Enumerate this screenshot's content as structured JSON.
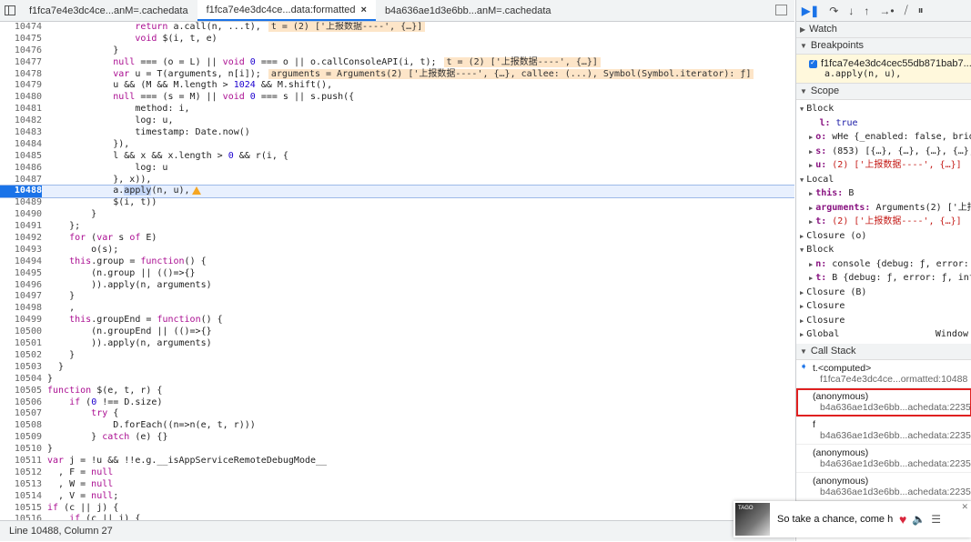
{
  "tabs": [
    {
      "label": "f1fca7e4e3dc4ce...anM=.cachedata",
      "active": false,
      "closable": false
    },
    {
      "label": "f1fca7e4e3dc4ce...data:formatted",
      "active": true,
      "closable": true
    },
    {
      "label": "b4a636ae1d3e6bb...anM=.cachedata",
      "active": false,
      "closable": false
    }
  ],
  "editor": {
    "lines": [
      {
        "n": "10474",
        "html": "                <span class=\"kw\">return</span> a.call(n, ...t),<span class=\"inline-val\">t = (2) ['上报数据----', {…}]</span>"
      },
      {
        "n": "10475",
        "html": "                <span class=\"kw\">void</span> $(i, t, e)"
      },
      {
        "n": "10476",
        "html": "            }"
      },
      {
        "n": "10477",
        "html": "            <span class=\"kw\">null</span> === (o = L) || <span class=\"kw\">void</span> <span class=\"num\">0</span> === o || o.callConsoleAPI(i, t);<span class=\"inline-val\">t = (2) ['上报数据----', {…}]</span>"
      },
      {
        "n": "10478",
        "html": "            <span class=\"kw\">var</span> u = T(arguments, n[i]);<span class=\"inline-val\">arguments = Arguments(2) ['上报数据----', {…}, callee: (...), Symbol(Symbol.iterator): ƒ]</span>"
      },
      {
        "n": "10479",
        "html": "            u && (M && M.length > <span class=\"num\">1024</span> && M.shift(),"
      },
      {
        "n": "10480",
        "html": "            <span class=\"kw\">null</span> === (s = M) || <span class=\"kw\">void</span> <span class=\"num\">0</span> === s || s.push({"
      },
      {
        "n": "10481",
        "html": "                method: i,"
      },
      {
        "n": "10482",
        "html": "                log: u,"
      },
      {
        "n": "10483",
        "html": "                timestamp: Date.now()"
      },
      {
        "n": "10484",
        "html": "            }),"
      },
      {
        "n": "10485",
        "html": "            l && x && x.length > <span class=\"num\">0</span> && r(i, {"
      },
      {
        "n": "10486",
        "html": "                log: u"
      },
      {
        "n": "10487",
        "html": "            }, x)),"
      },
      {
        "n": "10488",
        "html": "            a.<span class=\"hl-apply\">apply</span>(n, u),<span class=\"warn\"></span>",
        "current": true
      },
      {
        "n": "10489",
        "html": "            $(i, t))"
      },
      {
        "n": "10490",
        "html": "        }"
      },
      {
        "n": "10491",
        "html": "    };"
      },
      {
        "n": "10492",
        "html": "    <span class=\"kw\">for</span> (<span class=\"kw\">var</span> s <span class=\"kw\">of</span> E)"
      },
      {
        "n": "10493",
        "html": "        o(s);"
      },
      {
        "n": "10494",
        "html": "    <span class=\"kw\">this</span>.group = <span class=\"kw\">function</span>() {"
      },
      {
        "n": "10495",
        "html": "        (n.group || (()=>{}"
      },
      {
        "n": "10496",
        "html": "        )).apply(n, arguments)"
      },
      {
        "n": "10497",
        "html": "    }"
      },
      {
        "n": "10498",
        "html": "    ,"
      },
      {
        "n": "10499",
        "html": "    <span class=\"kw\">this</span>.groupEnd = <span class=\"kw\">function</span>() {"
      },
      {
        "n": "10500",
        "html": "        (n.groupEnd || (()=>{}"
      },
      {
        "n": "10501",
        "html": "        )).apply(n, arguments)"
      },
      {
        "n": "10502",
        "html": "    }"
      },
      {
        "n": "10503",
        "html": "  }"
      },
      {
        "n": "10504",
        "html": "}"
      },
      {
        "n": "10505",
        "html": "<span class=\"kw\">function</span> $(e, t, r) {"
      },
      {
        "n": "10506",
        "html": "    <span class=\"kw\">if</span> (<span class=\"num\">0</span> !== D.size)"
      },
      {
        "n": "10507",
        "html": "        <span class=\"kw\">try</span> {"
      },
      {
        "n": "10508",
        "html": "            D.forEach((n=>n(e, t, r)))"
      },
      {
        "n": "10509",
        "html": "        } <span class=\"kw\">catch</span> (e) {}"
      },
      {
        "n": "10510",
        "html": "}"
      },
      {
        "n": "10511",
        "html": "<span class=\"kw\">var</span> j = !u && !!e.g.__isAppServiceRemoteDebugMode__"
      },
      {
        "n": "10512",
        "html": "  , F = <span class=\"kw\">null</span>"
      },
      {
        "n": "10513",
        "html": "  , W = <span class=\"kw\">null</span>"
      },
      {
        "n": "10514",
        "html": "  , V = <span class=\"kw\">null</span>;"
      },
      {
        "n": "10515",
        "html": "<span class=\"kw\">if</span> (c || j) {"
      },
      {
        "n": "10516",
        "html": "    <span class=\"kw\">if</span> (c || j) {"
      }
    ]
  },
  "status": {
    "position": "Line 10488, Column 27",
    "coverage": "C"
  },
  "debugger": {
    "toolbar": [
      "resume-icon",
      "step-over-icon",
      "step-into-icon",
      "step-out-icon",
      "step-icon",
      "deactivate-breakpoints-icon",
      "pause-on-exceptions-icon"
    ],
    "sections": {
      "watch": "Watch",
      "breakpoints": "Breakpoints",
      "scope": "Scope",
      "callstack": "Call Stack"
    },
    "breakpoint": {
      "file": "f1fca7e4e3dc4cec55db871bab7...",
      "code": "a.apply(n, u),"
    },
    "scope": [
      {
        "level": 0,
        "tri": "▼",
        "text": "Block"
      },
      {
        "level": 1,
        "tri": "",
        "key": "l",
        "val": "true",
        "cls": "kw2"
      },
      {
        "level": 1,
        "tri": "▶",
        "key": "o",
        "val": "wHe {_enabled: false, bridg"
      },
      {
        "level": 1,
        "tri": "▶",
        "key": "s",
        "val": "(853) [{…}, {…}, {…}, {…},"
      },
      {
        "level": 1,
        "tri": "▶",
        "key": "u",
        "val": "(2) ['上报数据----', {…}]",
        "cls": "strv"
      },
      {
        "level": 0,
        "tri": "▼",
        "text": "Local"
      },
      {
        "level": 1,
        "tri": "▶",
        "key": "this",
        "val": "B",
        "plain": true
      },
      {
        "level": 1,
        "tri": "▶",
        "key": "arguments",
        "val": "Arguments(2) ['上报"
      },
      {
        "level": 1,
        "tri": "▶",
        "key": "t",
        "val": "(2) ['上报数据----', {…}]",
        "cls": "strv"
      },
      {
        "level": 0,
        "tri": "▶",
        "text": "Closure (o)"
      },
      {
        "level": 0,
        "tri": "▼",
        "text": "Block"
      },
      {
        "level": 1,
        "tri": "▶",
        "key": "n",
        "val": "console {debug: ƒ, error: ƒ"
      },
      {
        "level": 1,
        "tri": "▶",
        "key": "t",
        "val": "B {debug: ƒ, error: ƒ, info"
      },
      {
        "level": 0,
        "tri": "▶",
        "text": "Closure (B)"
      },
      {
        "level": 0,
        "tri": "▶",
        "text": "Closure"
      },
      {
        "level": 0,
        "tri": "▶",
        "text": "Closure"
      },
      {
        "level": 0,
        "tri": "▶",
        "text": "Global",
        "right": "Window"
      }
    ],
    "callstack": [
      {
        "name": "t.<computed>",
        "loc": "f1fca7e4e3dc4ce...ormatted:10488",
        "current": true
      },
      {
        "name": "(anonymous)",
        "loc": "b4a636ae1d3e6bb...achedata:22356",
        "selected": true
      },
      {
        "name": "f",
        "loc": "b4a636ae1d3e6bb...achedata:22359"
      },
      {
        "name": "(anonymous)",
        "loc": "b4a636ae1d3e6bb...achedata:22359"
      },
      {
        "name": "(anonymous)",
        "loc": "b4a636ae1d3e6bb...achedata:22359"
      }
    ]
  },
  "media": {
    "title": "So take a chance, come h",
    "cover_text": "TAGO"
  }
}
